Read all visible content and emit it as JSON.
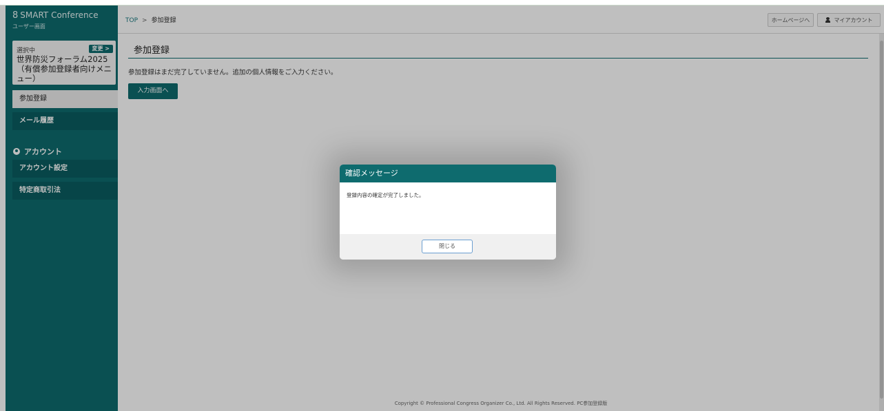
{
  "app": {
    "brand_logo": "8",
    "brand": "SMART Conference",
    "subtitle": "ユーザー画面"
  },
  "sidebar": {
    "selected_label": "選択中",
    "change_label": "変更 >",
    "selected_event": "世界防災フォーラム2025（有償参加登録者向けメニュー）",
    "items": [
      {
        "label": "参加登録",
        "active": true
      },
      {
        "label": "メール履歴",
        "active": false
      }
    ],
    "account_section": "アカウント",
    "account_items": [
      {
        "label": "アカウント設定"
      },
      {
        "label": "特定商取引法"
      }
    ]
  },
  "header": {
    "breadcrumb_top": "TOP",
    "breadcrumb_sep": ">",
    "breadcrumb_current": "参加登録",
    "homepage_button": "ホームページへ",
    "my_account_button": "マイアカウント"
  },
  "main": {
    "title": "参加登録",
    "message": "参加登録はまだ完了していません。追加の個人情報をご入力ください。",
    "entry_button": "入力画面へ"
  },
  "footer": {
    "copyright": "Copyright © Professional Congress Organizer Co., Ltd. All Rights Reserved. PC参加登録版"
  },
  "modal": {
    "title": "確認メッセージ",
    "body": "登録内容の確定が完了しました。",
    "close_button": "閉じる"
  },
  "colors": {
    "primary": "#0e6b6e",
    "overlay": "rgba(0,0,0,0.25)"
  }
}
